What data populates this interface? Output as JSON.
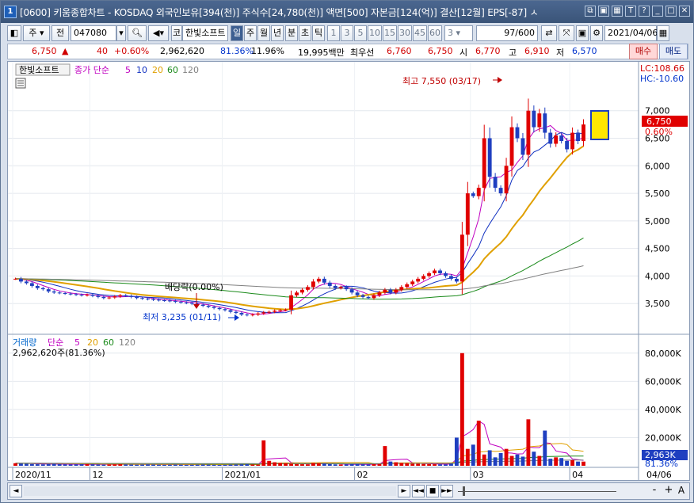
{
  "title": {
    "window_no": "1",
    "text": "[0600] 키움종합차트 - KOSDAQ 외국인보유[394(천)] 주식수[24,780(천)] 액면[500] 자본금[124(억)] 결산[12월] EPS[-87] ㅅ"
  },
  "toolbar": {
    "type_main": "주",
    "type_all": "전",
    "code": "047080",
    "market": "코",
    "stock_name": "한빛소프트",
    "periods": [
      "일",
      "주",
      "월",
      "년",
      "분",
      "초",
      "틱"
    ],
    "selected_period": "일",
    "intervals": [
      "1",
      "3",
      "5",
      "10",
      "15",
      "30",
      "45",
      "60"
    ],
    "count_select": "3",
    "page_count": "97/600",
    "date": "2021/04/06"
  },
  "quote": {
    "price": "6,750",
    "change_arrow": "▲",
    "change": "40",
    "change_rate": "+0.60%",
    "volume": "2,962,620",
    "volume_ratio": "81.36%",
    "turnover": "11.96%",
    "amount": "19,995백만",
    "best_label": "최우선",
    "best_ask": "6,760",
    "best_bid": "6,750",
    "open_label": "시",
    "open": "6,770",
    "high_label": "고",
    "high": "6,910",
    "low_label": "저",
    "low": "6,570",
    "buy_label": "매수",
    "sell_label": "매도"
  },
  "price_panel": {
    "name": "한빛소프트",
    "ma_label": "종가 단순",
    "ma_periods": [
      {
        "label": "5",
        "color": "#c000c0"
      },
      {
        "label": "10",
        "color": "#1030c0"
      },
      {
        "label": "20",
        "color": "#e0a000"
      },
      {
        "label": "60",
        "color": "#1a8a1a"
      },
      {
        "label": "120",
        "color": "#808080"
      }
    ],
    "lc": "LC:108.66",
    "hc": "HC:-10.60",
    "high_annotation": "최고 7,550 (03/17)",
    "low_annotation": "최저 3,235 (01/11)",
    "dividend_annotation": "배당락(0.00%)",
    "current_price_tag": "6,750",
    "current_rate_tag": "0.60%"
  },
  "volume_panel": {
    "name": "거래량",
    "ma_label": "단순",
    "ma_periods": [
      {
        "label": "5",
        "color": "#c000c0"
      },
      {
        "label": "20",
        "color": "#e0a000"
      },
      {
        "label": "60",
        "color": "#1a8a1a"
      },
      {
        "label": "120",
        "color": "#808080"
      }
    ],
    "current": "2,962,620주(81.36%)",
    "current_tag": "2,963K",
    "current_rate_tag": "81.36%"
  },
  "colors": {
    "up": "#e00000",
    "down": "#1f3fc0",
    "accent_box": "#ffe600"
  },
  "chart_data": {
    "type": "candlestick",
    "price_axis": {
      "ticks": [
        "7,000",
        "6,500",
        "6,000",
        "5,500",
        "5,000",
        "4,500",
        "4,000",
        "3,500"
      ],
      "ylim": [
        3000,
        7600
      ]
    },
    "volume_axis": {
      "ticks": [
        "80,000K",
        "60,000K",
        "40,000K",
        "20,000K"
      ],
      "ylim": [
        0,
        90000
      ]
    },
    "x_labels": [
      "2020/11",
      "12",
      "2021/01",
      "02",
      "03",
      "04"
    ],
    "x_current_label": "04/06",
    "closes": [
      3950,
      3900,
      3870,
      3820,
      3780,
      3760,
      3720,
      3700,
      3690,
      3680,
      3670,
      3660,
      3650,
      3660,
      3640,
      3620,
      3600,
      3610,
      3630,
      3650,
      3640,
      3620,
      3600,
      3590,
      3580,
      3570,
      3560,
      3555,
      3545,
      3530,
      3520,
      3510,
      3495,
      3480,
      3460,
      3440,
      3420,
      3400,
      3380,
      3350,
      3330,
      3300,
      3290,
      3300,
      3320,
      3340,
      3350,
      3370,
      3380,
      3390,
      3650,
      3700,
      3750,
      3800,
      3900,
      3950,
      3880,
      3820,
      3780,
      3800,
      3760,
      3700,
      3650,
      3620,
      3600,
      3650,
      3700,
      3750,
      3700,
      3750,
      3800,
      3850,
      3900,
      3950,
      4000,
      4050,
      4100,
      4050,
      4000,
      3950,
      3900,
      4750,
      5500,
      5450,
      5600,
      6500,
      5800,
      5600,
      5500,
      6000,
      6700,
      6500,
      6200,
      7000,
      6700,
      6950,
      6600,
      6400,
      6550,
      6450,
      6300,
      6600,
      6450,
      6750
    ],
    "ma_periods": [
      5,
      10,
      20,
      60,
      120
    ],
    "volumes_thousands": [
      1800,
      1500,
      1400,
      1200,
      1100,
      1000,
      1200,
      1300,
      1100,
      1000,
      900,
      1000,
      1100,
      1200,
      1000,
      900,
      800,
      900,
      1000,
      1100,
      1000,
      900,
      800,
      900,
      1000,
      900,
      800,
      700,
      800,
      900,
      800,
      700,
      700,
      800,
      900,
      800,
      700,
      600,
      700,
      800,
      900,
      1000,
      1100,
      900,
      800,
      18000,
      3500,
      2500,
      2000,
      1800,
      1500,
      1200,
      1100,
      1000,
      2000,
      1800,
      1600,
      1200,
      1000,
      900,
      1000,
      1100,
      1200,
      1000,
      900,
      1200,
      1300,
      14000,
      3000,
      2500,
      2000,
      1800,
      1500,
      1400,
      1300,
      1200,
      1100,
      1000,
      900,
      1500,
      20000,
      80000,
      12000,
      15000,
      32000,
      8000,
      11000,
      6000,
      9000,
      12000,
      7000,
      8000,
      6500,
      33000,
      10000,
      7000,
      25000,
      5000,
      6000,
      5500,
      3500,
      4000,
      3000,
      2963
    ]
  },
  "scroll": {
    "buttons": [
      "◄",
      "►",
      "◄◄",
      "■",
      "►►",
      "-",
      "+",
      "A"
    ]
  }
}
